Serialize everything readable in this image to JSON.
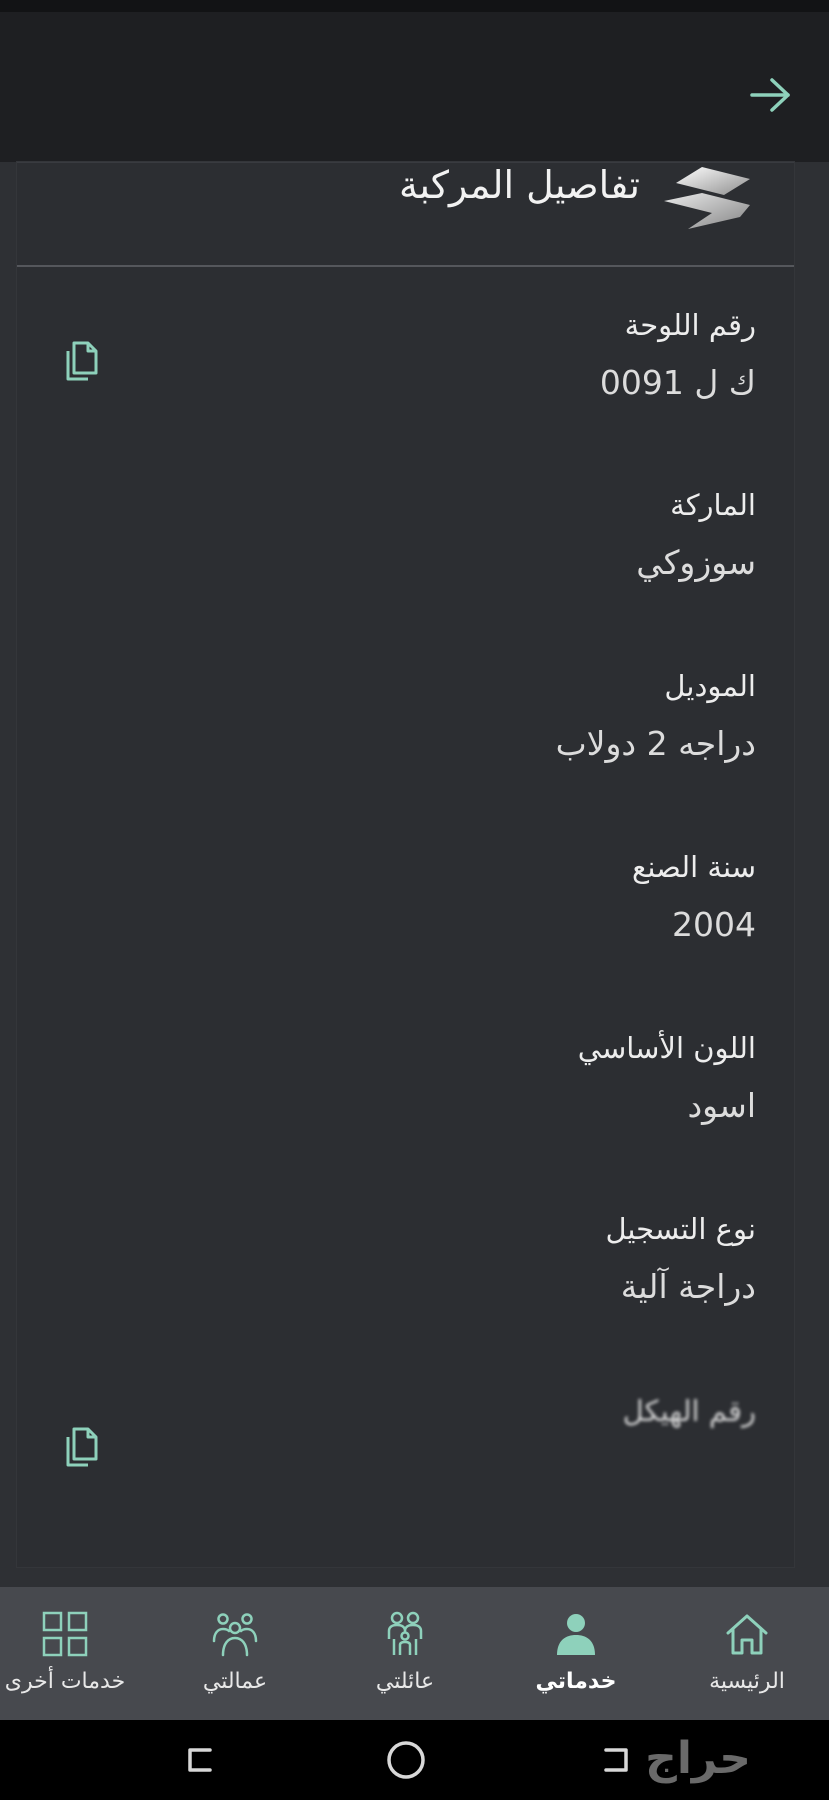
{
  "header": {
    "back_icon": "arrow-right-icon"
  },
  "card": {
    "title": "تفاصيل المركبة",
    "fields": [
      {
        "label": "رقم اللوحة",
        "value": "ك ل 0091",
        "copyable": true
      },
      {
        "label": "الماركة",
        "value": "سوزوكي"
      },
      {
        "label": "الموديل",
        "value": "دراجه 2 دولاب"
      },
      {
        "label": "سنة الصنع",
        "value": "2004"
      },
      {
        "label": "اللون الأساسي",
        "value": "اسود"
      },
      {
        "label": "نوع التسجيل",
        "value": "دراجة آلية"
      },
      {
        "label": "رقم الهيكل",
        "value": "",
        "copyable": true
      }
    ]
  },
  "bottom_nav": {
    "items": [
      {
        "label": "الرئيسية",
        "icon": "home-icon"
      },
      {
        "label": "خدماتي",
        "icon": "person-icon",
        "active": true
      },
      {
        "label": "عائلتي",
        "icon": "family-icon"
      },
      {
        "label": "عمالتي",
        "icon": "workers-icon"
      },
      {
        "label": "خدمات أخرى",
        "icon": "grid-icon"
      }
    ]
  },
  "colors": {
    "accent": "#8ed1bb",
    "background": "#2e3034",
    "nav_bg": "#47494e"
  },
  "system_bar": {
    "watermark": "حراج"
  }
}
